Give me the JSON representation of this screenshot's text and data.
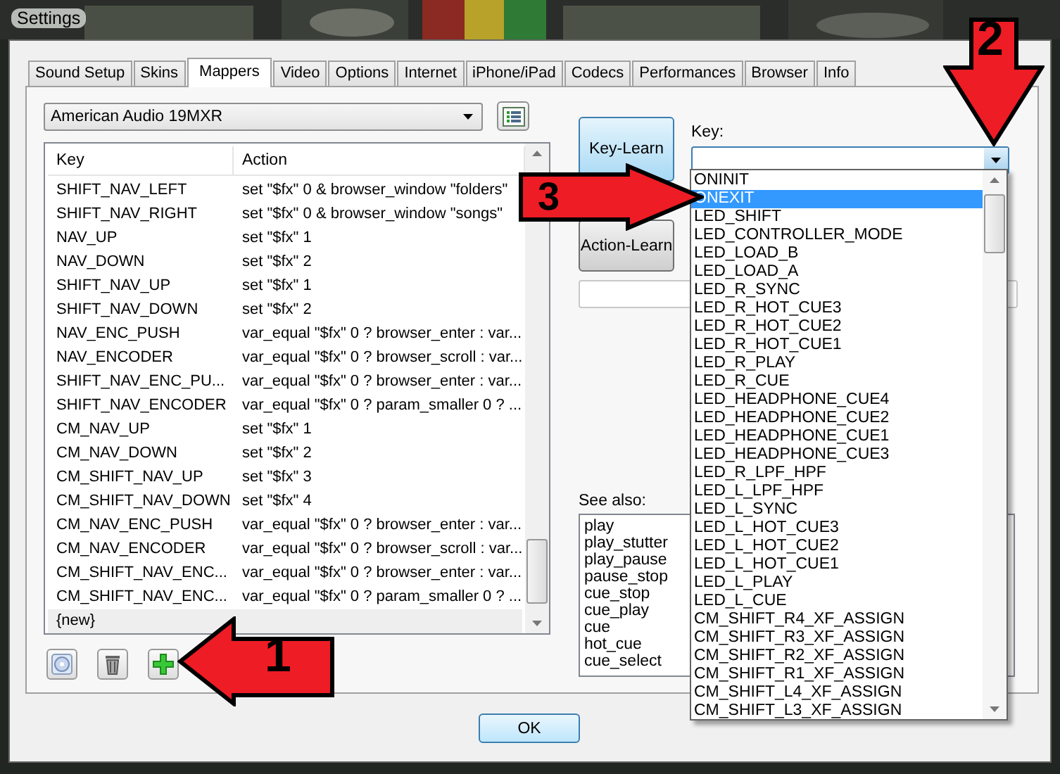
{
  "window": {
    "title": "Settings"
  },
  "tabs": [
    {
      "label": "Sound Setup",
      "selected": false
    },
    {
      "label": "Skins",
      "selected": false
    },
    {
      "label": "Mappers",
      "selected": true
    },
    {
      "label": "Video",
      "selected": false
    },
    {
      "label": "Options",
      "selected": false
    },
    {
      "label": "Internet",
      "selected": false
    },
    {
      "label": "iPhone/iPad",
      "selected": false
    },
    {
      "label": "Codecs",
      "selected": false
    },
    {
      "label": "Performances",
      "selected": false
    },
    {
      "label": "Browser",
      "selected": false
    },
    {
      "label": "Info",
      "selected": false
    }
  ],
  "device": {
    "value": "American Audio 19MXR"
  },
  "mapping_table": {
    "columns": [
      "Key",
      "Action"
    ],
    "rows": [
      {
        "key": "SHIFT_NAV_LEFT",
        "action": "set \"$fx\" 0 & browser_window \"folders\""
      },
      {
        "key": "SHIFT_NAV_RIGHT",
        "action": "set \"$fx\" 0 & browser_window \"songs\""
      },
      {
        "key": "NAV_UP",
        "action": "set \"$fx\" 1"
      },
      {
        "key": "NAV_DOWN",
        "action": "set \"$fx\" 2"
      },
      {
        "key": "SHIFT_NAV_UP",
        "action": "set \"$fx\" 1"
      },
      {
        "key": "SHIFT_NAV_DOWN",
        "action": "set \"$fx\" 2"
      },
      {
        "key": "NAV_ENC_PUSH",
        "action": "var_equal \"$fx\" 0 ? browser_enter : var..."
      },
      {
        "key": "NAV_ENCODER",
        "action": "var_equal \"$fx\" 0 ? browser_scroll : var..."
      },
      {
        "key": "SHIFT_NAV_ENC_PU...",
        "action": "var_equal \"$fx\" 0 ? browser_enter : var..."
      },
      {
        "key": "SHIFT_NAV_ENCODER",
        "action": "var_equal \"$fx\" 0 ? param_smaller 0 ? ..."
      },
      {
        "key": "CM_NAV_UP",
        "action": "set \"$fx\" 1"
      },
      {
        "key": "CM_NAV_DOWN",
        "action": "set \"$fx\" 2"
      },
      {
        "key": "CM_SHIFT_NAV_UP",
        "action": "set \"$fx\" 3"
      },
      {
        "key": "CM_SHIFT_NAV_DOWN",
        "action": "set \"$fx\" 4"
      },
      {
        "key": "CM_NAV_ENC_PUSH",
        "action": "var_equal \"$fx\" 0 ? browser_enter : var..."
      },
      {
        "key": "CM_NAV_ENCODER",
        "action": "var_equal \"$fx\" 0 ? browser_scroll : var..."
      },
      {
        "key": "CM_SHIFT_NAV_ENC...",
        "action": "var_equal \"$fx\" 0 ? browser_enter : var..."
      },
      {
        "key": "CM_SHIFT_NAV_ENC...",
        "action": "var_equal \"$fx\" 0 ? param_smaller 0 ? ..."
      }
    ],
    "new_row": "{new}"
  },
  "key_learn": "Key-Learn",
  "action_learn": "Action-Learn",
  "key_label": "Key:",
  "key_dropdown": {
    "items": [
      {
        "label": "ONINIT",
        "selected": false
      },
      {
        "label": "ONEXIT",
        "selected": true
      },
      {
        "label": "LED_SHIFT",
        "selected": false
      },
      {
        "label": "LED_CONTROLLER_MODE",
        "selected": false
      },
      {
        "label": "LED_LOAD_B",
        "selected": false
      },
      {
        "label": "LED_LOAD_A",
        "selected": false
      },
      {
        "label": "LED_R_SYNC",
        "selected": false
      },
      {
        "label": "LED_R_HOT_CUE3",
        "selected": false
      },
      {
        "label": "LED_R_HOT_CUE2",
        "selected": false
      },
      {
        "label": "LED_R_HOT_CUE1",
        "selected": false
      },
      {
        "label": "LED_R_PLAY",
        "selected": false
      },
      {
        "label": "LED_R_CUE",
        "selected": false
      },
      {
        "label": "LED_HEADPHONE_CUE4",
        "selected": false
      },
      {
        "label": "LED_HEADPHONE_CUE2",
        "selected": false
      },
      {
        "label": "LED_HEADPHONE_CUE1",
        "selected": false
      },
      {
        "label": "LED_HEADPHONE_CUE3",
        "selected": false
      },
      {
        "label": "LED_R_LPF_HPF",
        "selected": false
      },
      {
        "label": "LED_L_LPF_HPF",
        "selected": false
      },
      {
        "label": "LED_L_SYNC",
        "selected": false
      },
      {
        "label": "LED_L_HOT_CUE3",
        "selected": false
      },
      {
        "label": "LED_L_HOT_CUE2",
        "selected": false
      },
      {
        "label": "LED_L_HOT_CUE1",
        "selected": false
      },
      {
        "label": "LED_L_PLAY",
        "selected": false
      },
      {
        "label": "LED_L_CUE",
        "selected": false
      },
      {
        "label": "CM_SHIFT_R4_XF_ASSIGN",
        "selected": false
      },
      {
        "label": "CM_SHIFT_R3_XF_ASSIGN",
        "selected": false
      },
      {
        "label": "CM_SHIFT_R2_XF_ASSIGN",
        "selected": false
      },
      {
        "label": "CM_SHIFT_R1_XF_ASSIGN",
        "selected": false
      },
      {
        "label": "CM_SHIFT_L4_XF_ASSIGN",
        "selected": false
      },
      {
        "label": "CM_SHIFT_L3_XF_ASSIGN",
        "selected": false
      }
    ]
  },
  "see_also": {
    "label": "See also:",
    "items": [
      "play",
      "play_stutter",
      "play_pause",
      "pause_stop",
      "cue_stop",
      "cue_play",
      "cue",
      "hot_cue",
      "cue_select"
    ]
  },
  "ok_button": "OK",
  "annotations": [
    {
      "number": "1",
      "kind": "left"
    },
    {
      "number": "2",
      "kind": "down"
    },
    {
      "number": "3",
      "kind": "right"
    }
  ]
}
